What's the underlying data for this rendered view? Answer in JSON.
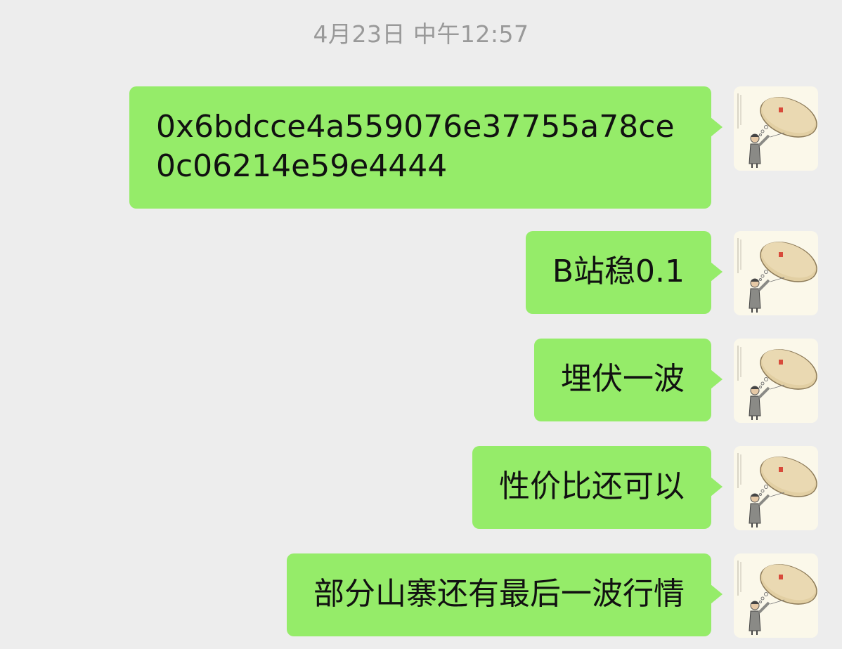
{
  "timestamp": "4月23日 中午12:57",
  "colors": {
    "background": "#ededed",
    "bubble": "#95ec69",
    "timestamp_text": "#999999"
  },
  "messages": [
    {
      "text": "0x6bdcce4a559076e37755a78ce0c06214e59e4444",
      "sender": "self",
      "avatar_icon": "pie-in-the-sky-cartoon-avatar"
    },
    {
      "text": "B站稳0.1",
      "sender": "self",
      "avatar_icon": "pie-in-the-sky-cartoon-avatar"
    },
    {
      "text": "埋伏一波",
      "sender": "self",
      "avatar_icon": "pie-in-the-sky-cartoon-avatar"
    },
    {
      "text": "性价比还可以",
      "sender": "self",
      "avatar_icon": "pie-in-the-sky-cartoon-avatar"
    },
    {
      "text": "部分山寨还有最后一波行情",
      "sender": "self",
      "avatar_icon": "pie-in-the-sky-cartoon-avatar"
    }
  ]
}
